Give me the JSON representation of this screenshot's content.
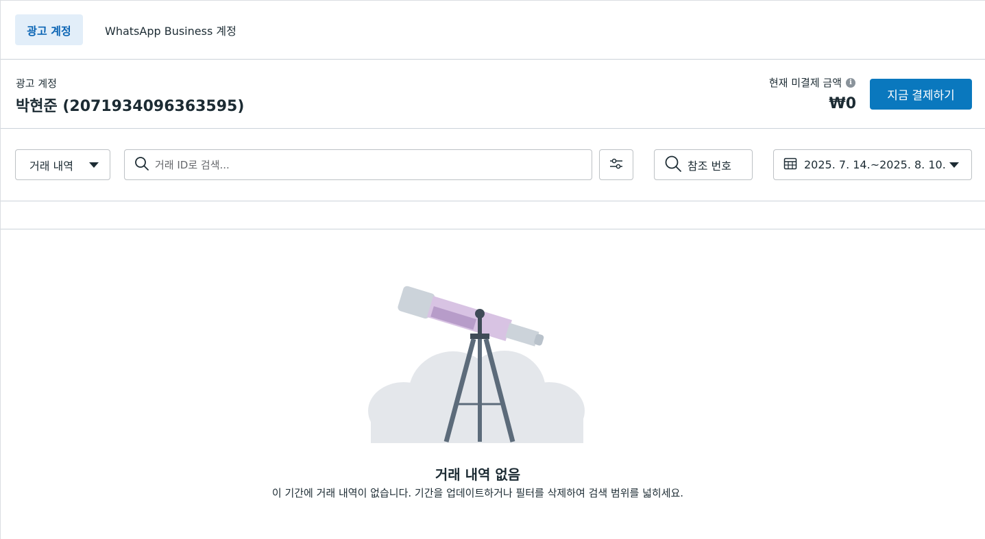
{
  "tabs": [
    {
      "label": "광고 계정",
      "active": true
    },
    {
      "label": "WhatsApp Business 계정",
      "active": false
    }
  ],
  "account": {
    "label": "광고 계정",
    "name": "박현준 (2071934096363595)",
    "due_label": "현재 미결제 금액",
    "due_amount": "₩0",
    "pay_button": "지금 결제하기"
  },
  "toolbar": {
    "type_dropdown": "거래 내역",
    "search_placeholder": "거래 ID로 검색...",
    "search_value": "",
    "reference_button": "참조 번호",
    "date_range": "2025. 7. 14.~2025. 8. 10."
  },
  "empty_state": {
    "title": "거래 내역 없음",
    "description": "이 기간에 거래 내역이 없습니다. 기간을 업데이트하거나 필터를 삭제하여 검색 범위를 넓히세요."
  },
  "colors": {
    "accent": "#0a78be",
    "active_tab_bg": "#e2eef9",
    "active_tab_text": "#0a64b4",
    "border": "#cbd2d9"
  },
  "icons": {
    "search": "search-icon",
    "filter": "sliders-icon",
    "reference": "search-icon",
    "calendar": "calendar-icon",
    "info": "info-icon"
  }
}
